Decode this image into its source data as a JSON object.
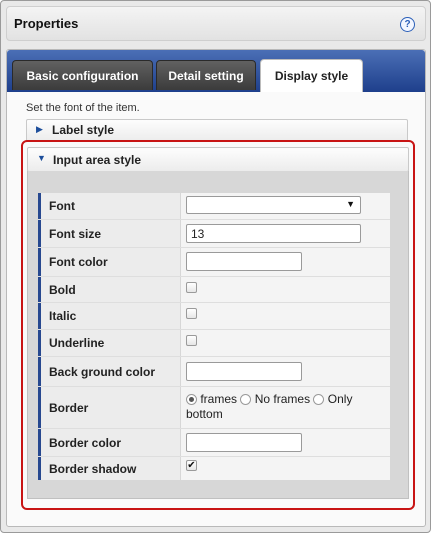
{
  "window": {
    "title": "Properties",
    "help_glyph": "?"
  },
  "tabs": [
    {
      "label": "Basic configuration",
      "active": false
    },
    {
      "label": "Detail setting",
      "active": false
    },
    {
      "label": "Display style",
      "active": true
    }
  ],
  "hint": "Set the font of the item.",
  "sections": {
    "label_style": {
      "title": "Label style",
      "expanded": false
    },
    "input_area_style": {
      "title": "Input area style",
      "expanded": true
    }
  },
  "fields": {
    "font": {
      "label": "Font",
      "value": ""
    },
    "font_size": {
      "label": "Font size",
      "value": "13"
    },
    "font_color": {
      "label": "Font color",
      "value": ""
    },
    "bold": {
      "label": "Bold",
      "checked": false
    },
    "italic": {
      "label": "Italic",
      "checked": false
    },
    "underline": {
      "label": "Underline",
      "checked": false
    },
    "back_ground_color": {
      "label": "Back ground color",
      "value": ""
    },
    "border": {
      "label": "Border",
      "options": [
        "frames",
        "No frames",
        "Only bottom"
      ],
      "selected": "frames"
    },
    "border_color": {
      "label": "Border color",
      "value": ""
    },
    "border_shadow": {
      "label": "Border shadow",
      "checked": true
    }
  },
  "glyphs": {
    "caret": "▼",
    "collapsed": "▶",
    "expanded": "▼",
    "check": "✔"
  },
  "colors": {
    "tab_bar": "#1e3f8c",
    "highlight_frame": "#c81414",
    "row_accent": "#27488f"
  }
}
